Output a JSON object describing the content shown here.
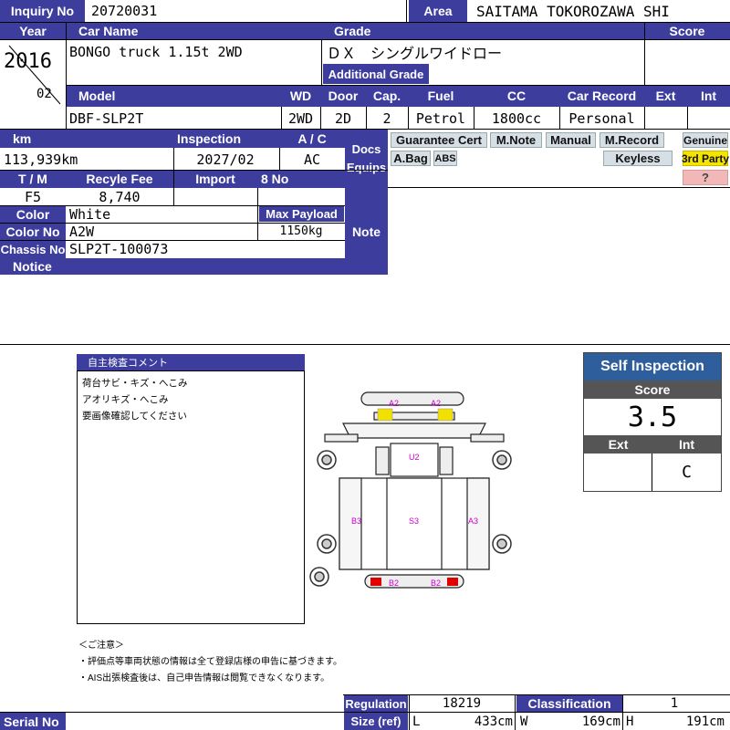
{
  "header": {
    "inquiry_label": "Inquiry No",
    "inquiry_value": "20720031",
    "area_label": "Area",
    "area_value": "SAITAMA TOKOROZAWA SHI"
  },
  "row1": {
    "year_label": "Year",
    "car_name_label": "Car Name",
    "grade_label": "Grade",
    "score_label": "Score",
    "year_value": "2016",
    "month_value": "02",
    "car_name_value": "BONGO truck 1.15t 2WD",
    "grade_value": "ＤＸ　シングルワイドロー",
    "additional_grade_label": "Additional Grade"
  },
  "row2": {
    "model_label": "Model",
    "wd_label": "WD",
    "door_label": "Door",
    "cap_label": "Cap.",
    "fuel_label": "Fuel",
    "cc_label": "CC",
    "car_record_label": "Car Record",
    "ext_label": "Ext",
    "int_label": "Int",
    "model_value": "DBF-SLP2T",
    "wd_value": "2WD",
    "door_value": "2D",
    "cap_value": "2",
    "fuel_value": "Petrol",
    "cc_value": "1800cc",
    "car_record_value": "Personal"
  },
  "left_block": {
    "km_label": "km",
    "inspection_label": "Inspection",
    "ac_label": "A / C",
    "km_value": "113,939km",
    "inspection_value": "2027/02",
    "ac_value": "AC",
    "tm_label": "T / M",
    "recycle_label": "Recyle Fee",
    "import_label": "Import",
    "no8_label": "8 No",
    "tm_value": "F5",
    "recycle_value": "8,740",
    "color_label": "Color",
    "color_value": "White",
    "max_payload_label": "Max Payload",
    "color_no_label": "Color No",
    "color_no_value": "A2W",
    "max_payload_value": "1150kg",
    "chassis_label": "Chassis No",
    "chassis_value": "SLP2T-100073",
    "notice_label": "Notice"
  },
  "docs": {
    "label_line1": "Docs",
    "label_line2": "Equips",
    "badges": [
      "Guarantee Cert",
      "M.Note",
      "Manual",
      "M.Record",
      "A.Bag",
      "ABS",
      "Keyless"
    ],
    "genuine": "Genuine",
    "third_party": "3rd Party",
    "unknown": "?",
    "colors": {
      "third_party": "#f5e400",
      "unknown": "#f2b8b8"
    }
  },
  "note_label": "Note",
  "comment": {
    "title": "自主検査コメント",
    "lines": [
      "荷台サビ・キズ・へこみ",
      "アオリキズ・へこみ",
      "要画像確認してください"
    ]
  },
  "diagram": {
    "marks": [
      "A2",
      "A2",
      "U2",
      "B3",
      "S3",
      "A3",
      "B2",
      "B2"
    ],
    "colors": {
      "mark_text": "#cc00cc",
      "dent": "#f2e000",
      "scratch": "#e00000"
    }
  },
  "self_inspection": {
    "title": "Self Inspection",
    "score_label": "Score",
    "score_value": "3.5",
    "ext_label": "Ext",
    "int_label": "Int",
    "ext_value": "",
    "int_value": "C"
  },
  "notes": {
    "head": "＜ご注意＞",
    "line1": "・評価点等車両状態の情報は全て登録店様の申告に基づきます。",
    "line2": "・AIS出張検査後は、自己申告情報は閲覧できなくなります。"
  },
  "footer": {
    "regulation_label": "Regulation",
    "regulation_value": "18219",
    "classification_label": "Classification",
    "classification_value": "1",
    "serial_label": "Serial No",
    "size_label": "Size (ref)",
    "l_label": "L",
    "l_value": "433cm",
    "w_label": "W",
    "w_value": "169cm",
    "h_label": "H",
    "h_value": "191cm"
  }
}
